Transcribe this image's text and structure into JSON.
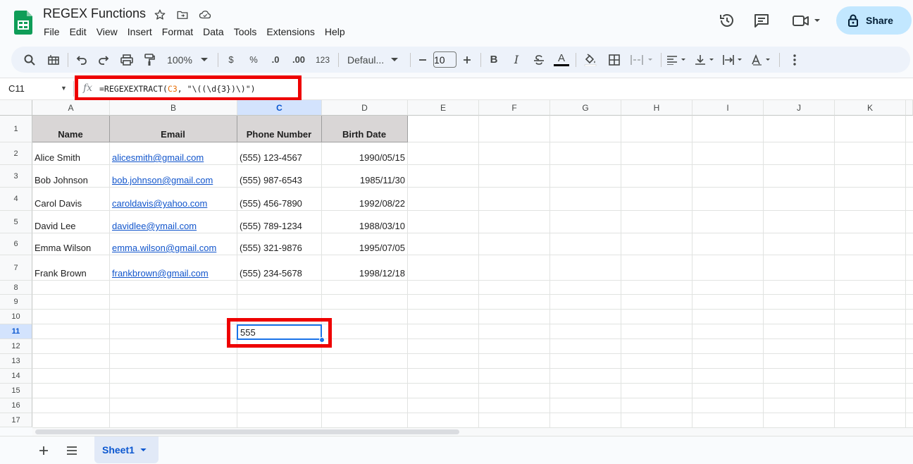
{
  "app": {
    "title": "REGEX Functions",
    "menu": [
      "File",
      "Edit",
      "View",
      "Insert",
      "Format",
      "Data",
      "Tools",
      "Extensions",
      "Help"
    ],
    "share_label": "Share"
  },
  "toolbar": {
    "zoom": "100%",
    "currency": "$",
    "percent": "%",
    "decrease_decimal": ".0",
    "increase_decimal": ".00",
    "number_format": "123",
    "font": "Defaul...",
    "font_size": "10",
    "bold": "B",
    "italic": "I",
    "text_color_glyph": "A"
  },
  "formula_bar": {
    "cell_ref": "C11",
    "fx": "fx",
    "formula_prefix": "=REGEXEXTRACT(",
    "formula_ref": "C3",
    "formula_suffix": ", \"\\((\\d{3})\\)\")"
  },
  "columns": [
    "A",
    "B",
    "C",
    "D",
    "E",
    "F",
    "G",
    "H",
    "I",
    "J",
    "K"
  ],
  "rows": [
    "1",
    "2",
    "3",
    "4",
    "5",
    "6",
    "7",
    "8",
    "9",
    "10",
    "11",
    "12",
    "13",
    "14",
    "15",
    "16",
    "17"
  ],
  "table": {
    "headers": [
      "Name",
      "Email",
      "Phone Number",
      "Birth Date"
    ],
    "data": [
      [
        "Alice Smith",
        "alicesmith@gmail.com",
        "(555) 123-4567",
        "1990/05/15"
      ],
      [
        "Bob Johnson",
        "bob.johnson@gmail.com",
        "(555) 987-6543",
        "1985/11/30"
      ],
      [
        "Carol Davis",
        "caroldavis@yahoo.com",
        "(555) 456-7890",
        "1992/08/22"
      ],
      [
        "David Lee",
        "davidlee@ymail.com",
        "(555) 789-1234",
        "1988/03/10"
      ],
      [
        "Emma Wilson",
        "emma.wilson@gmail.com",
        "(555) 321-9876",
        "1995/07/05"
      ],
      [
        "Frank Brown",
        "frankbrown@gmail.com",
        "(555) 234-5678",
        "1998/12/18"
      ]
    ]
  },
  "active_cell": {
    "ref": "C11",
    "value": "555"
  },
  "sheet_tab": {
    "label": "Sheet1"
  },
  "colors": {
    "accent": "#1a73e8",
    "share_bg": "#c2e7ff",
    "highlight_red": "#ee0000",
    "header_fill": "#d9d6d6",
    "link": "#1155cc"
  }
}
